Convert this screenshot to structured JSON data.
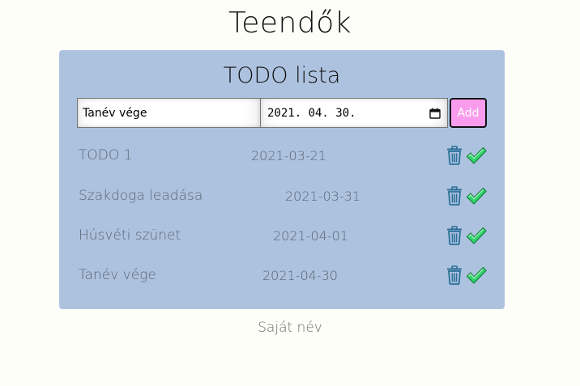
{
  "page": {
    "title": "Teendők",
    "footer": "Saját név"
  },
  "card": {
    "title": "TODO lista",
    "form": {
      "text_value": "Tanév vége",
      "date_value": "2021. 04. 30.",
      "add_label": "Add"
    },
    "todos": [
      {
        "title": "TODO 1",
        "date": "2021-03-21"
      },
      {
        "title": "Szakdoga leadása",
        "date": "2021-03-31"
      },
      {
        "title": "Húsvéti szünet",
        "date": "2021-04-01"
      },
      {
        "title": "Tanév vége",
        "date": "2021-04-30"
      }
    ]
  },
  "colors": {
    "page_bg": "#fefef9",
    "card_bg": "#adc2df",
    "add_button_bg": "#fa9ced",
    "trash": "#2a6f97",
    "check": "#22c55e"
  },
  "icons": {
    "delete": "trash-icon",
    "done": "check-icon",
    "calendar": "calendar-icon"
  }
}
